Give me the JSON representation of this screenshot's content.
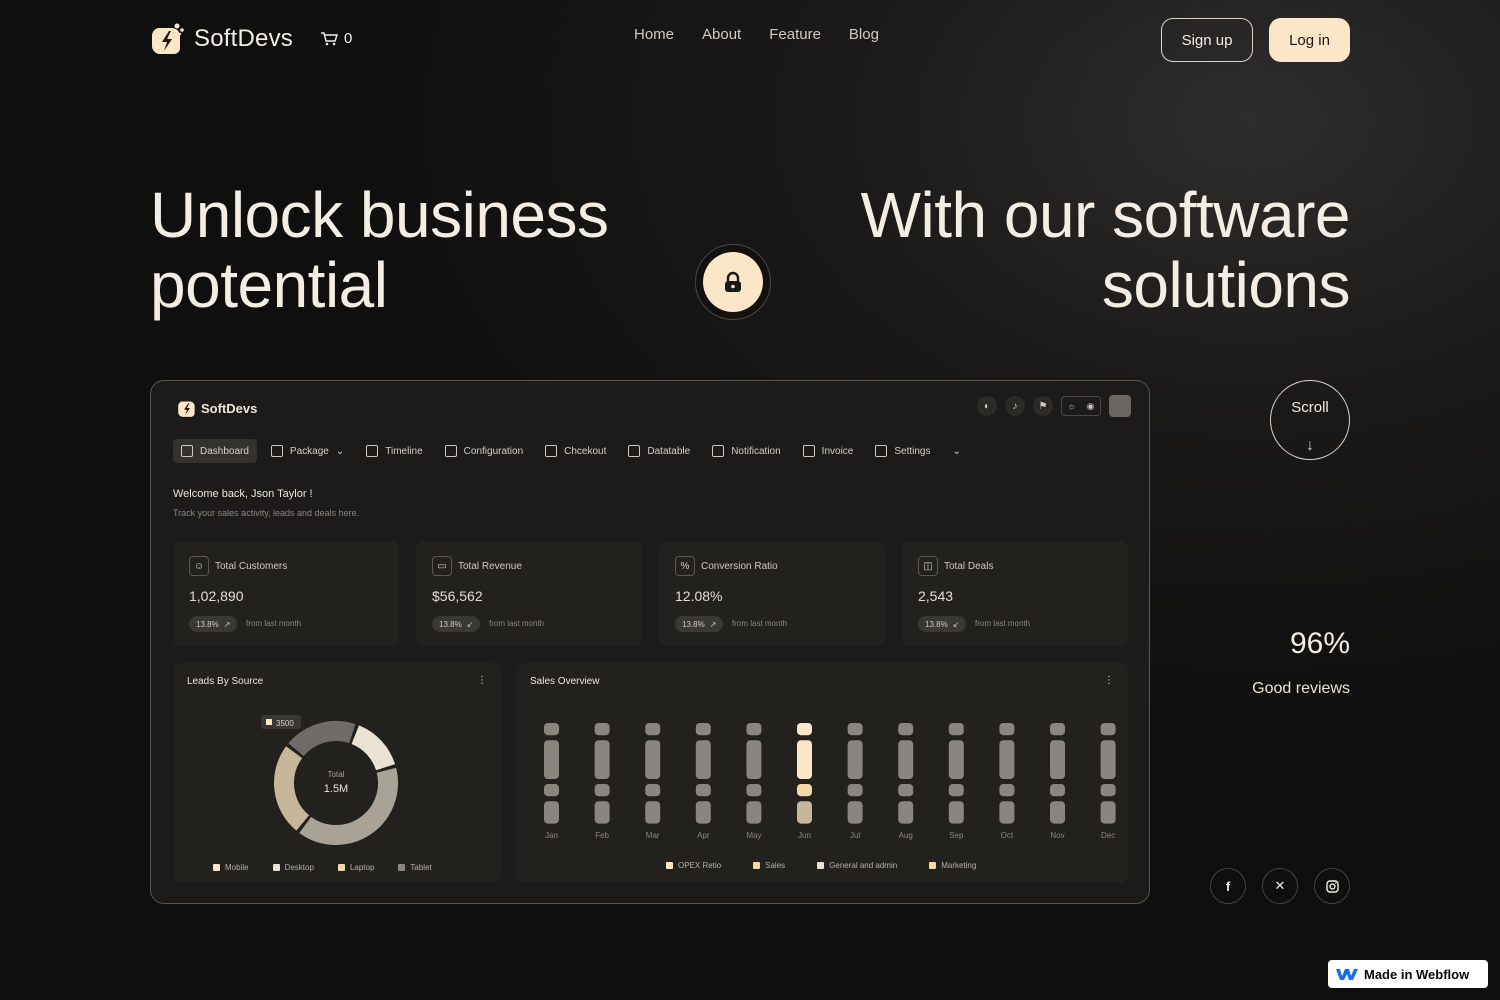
{
  "nav": {
    "brand": "SoftDevs",
    "cart_count": "0",
    "links": [
      "Home",
      "About",
      "Feature",
      "Blog"
    ],
    "signup_label": "Sign up",
    "login_label": "Log in"
  },
  "hero": {
    "left_line1": "Unlock business",
    "left_line2": "potential",
    "right_line1": "With our software",
    "right_line2": "solutions"
  },
  "dashboard": {
    "brand": "SoftDevs",
    "tabs": [
      {
        "label": "Dashboard",
        "icon": "grid-icon"
      },
      {
        "label": "Package",
        "icon": "box-icon"
      },
      {
        "label": "Timeline",
        "icon": "timeline-icon"
      },
      {
        "label": "Configuration",
        "icon": "file-cog-icon"
      },
      {
        "label": "Chcekout",
        "icon": "credit-card-icon"
      },
      {
        "label": "Datatable",
        "icon": "table-icon"
      },
      {
        "label": "Notification",
        "icon": "bell-icon"
      },
      {
        "label": "Invoice",
        "icon": "invoice-icon"
      },
      {
        "label": "Settings",
        "icon": "gear-icon"
      }
    ],
    "welcome": "Welcome back, Json Taylor !",
    "welcome_sub": "Track your sales activity, leads and deals here.",
    "stats": [
      {
        "label": "Total Customers",
        "value": "1,02,890",
        "badge": "13.8%",
        "note": "from last month",
        "trend": "up",
        "icon": "users-icon"
      },
      {
        "label": "Total Revenue",
        "value": "$56,562",
        "badge": "13.8%",
        "note": "from last month",
        "trend": "down",
        "icon": "wallet-icon"
      },
      {
        "label": "Conversion Ratio",
        "value": "12.08%",
        "badge": "13.8%",
        "note": "from last month",
        "trend": "up",
        "icon": "percent-icon"
      },
      {
        "label": "Total Deals",
        "value": "2,543",
        "badge": "13.8%",
        "note": "from last month",
        "trend": "down",
        "icon": "bag-icon"
      }
    ],
    "leads": {
      "title": "Leads By Source",
      "callout": "3500",
      "center_label": "Total",
      "center_value": "1.5M",
      "legend": [
        "Mobile",
        "Desktop",
        "Laptop",
        "Tablet"
      ]
    },
    "sales": {
      "title": "Sales Overview",
      "legend": [
        "OPEX Retio",
        "Sales",
        "General and admin",
        "Marketing"
      ]
    }
  },
  "side": {
    "scroll_label": "Scroll",
    "scroll_arrow": "↓",
    "percent": "96%",
    "percent_label": "Good reviews"
  },
  "badge": {
    "label": "Made in Webflow"
  },
  "colors": {
    "accent": "#fbe6c8",
    "background": "#111111",
    "panel": "#22211e"
  },
  "chart_data": [
    {
      "type": "pie",
      "title": "Leads By Source",
      "categories": [
        "Mobile",
        "Desktop",
        "Laptop",
        "Tablet"
      ],
      "values": [
        15,
        40,
        25,
        20
      ],
      "colors": [
        "#eae2d2",
        "#a8a297",
        "#c7b79a",
        "#6f6b66"
      ]
    },
    {
      "type": "bar",
      "title": "Sales Overview",
      "categories": [
        "Jan",
        "Feb",
        "Mar",
        "Apr",
        "May",
        "Jun",
        "Jul",
        "Aug",
        "Sep",
        "Oct",
        "Nov",
        "Dec"
      ],
      "series": [
        {
          "name": "OPEX Retio",
          "values": [
            1,
            1,
            1,
            1,
            1,
            1,
            1,
            1,
            1,
            1,
            1,
            1
          ]
        },
        {
          "name": "Sales",
          "values": [
            4,
            4,
            4,
            4,
            4,
            4,
            4,
            4,
            4,
            4,
            4,
            4
          ]
        },
        {
          "name": "General and admin",
          "values": [
            1,
            1,
            1,
            1,
            1,
            1,
            1,
            1,
            1,
            1,
            1,
            1
          ]
        },
        {
          "name": "Marketing",
          "values": [
            2,
            2,
            2,
            2,
            2,
            2,
            2,
            2,
            2,
            2,
            2,
            2
          ]
        }
      ],
      "highlight": "Jun"
    }
  ]
}
